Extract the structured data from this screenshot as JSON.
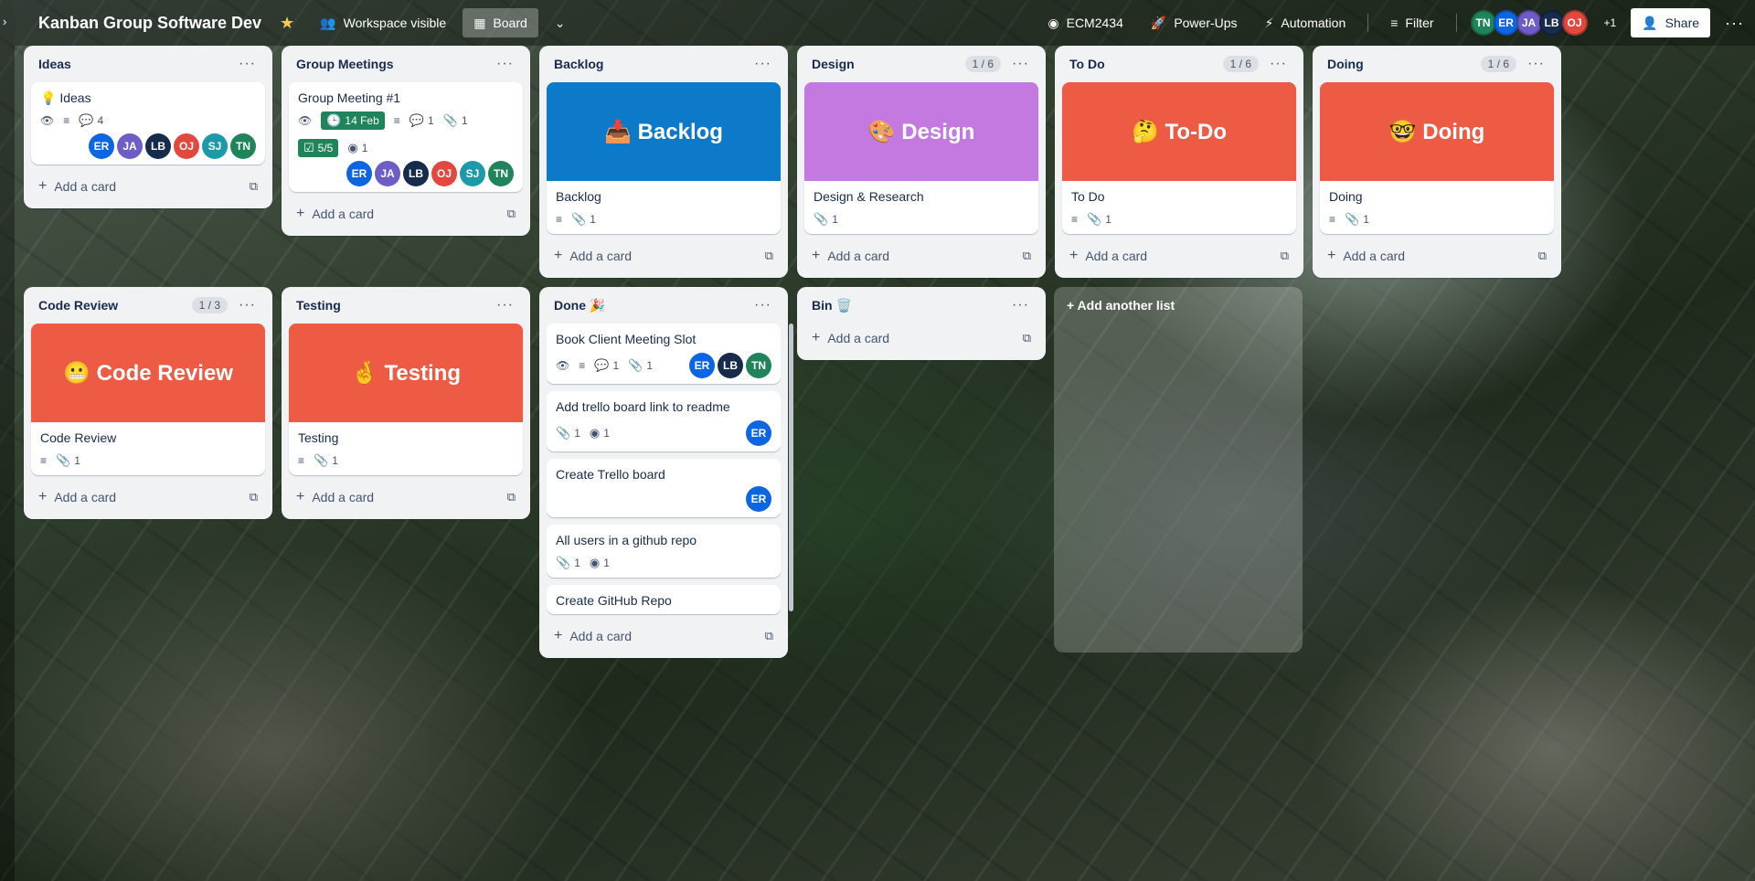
{
  "header": {
    "board_title": "Kanban Group Software Dev",
    "visibility": "Workspace visible",
    "view": "Board",
    "github": "ECM2434",
    "powerups": "Power-Ups",
    "automation": "Automation",
    "filter": "Filter",
    "share": "Share",
    "more_members": "+1"
  },
  "members": [
    {
      "initials": "TN",
      "color": "#1f845a"
    },
    {
      "initials": "ER",
      "color": "#0c66e4"
    },
    {
      "initials": "JA",
      "color": "#6e5dc6"
    },
    {
      "initials": "LB",
      "color": "#172b4d"
    },
    {
      "initials": "OJ",
      "color": "#e2483d"
    }
  ],
  "colors": {
    "er": "#0c66e4",
    "ja": "#6e5dc6",
    "lb": "#172b4d",
    "oj": "#e2483d",
    "sj": "#1d9aaa",
    "tn": "#1f845a",
    "backlog": "#0c7ac9",
    "design": "#c479e0",
    "red": "#ed5b45"
  },
  "add_card": "Add a card",
  "add_list": "+ Add another list",
  "lists": {
    "ideas": {
      "title": "Ideas",
      "card": {
        "title": "Ideas",
        "comments": "4"
      }
    },
    "meetings": {
      "title": "Group Meetings",
      "card": {
        "title": "Group Meeting #1",
        "due": "14 Feb",
        "comments": "1",
        "attachments": "1",
        "checklist": "5/5",
        "github": "1"
      }
    },
    "backlog": {
      "title": "Backlog",
      "cover": "📥 Backlog",
      "card": {
        "title": "Backlog",
        "attachments": "1"
      }
    },
    "design": {
      "title": "Design",
      "count": "1 / 6",
      "cover": "🎨 Design",
      "card": {
        "title": "Design & Research",
        "attachments": "1"
      }
    },
    "todo": {
      "title": "To Do",
      "count": "1 / 6",
      "cover": "🤔 To-Do",
      "card": {
        "title": "To Do",
        "attachments": "1"
      }
    },
    "doing": {
      "title": "Doing",
      "count": "1 / 6",
      "cover": "🤓 Doing",
      "card": {
        "title": "Doing",
        "attachments": "1"
      }
    },
    "review": {
      "title": "Code Review",
      "count": "1 / 3",
      "cover": "😬 Code Review",
      "card": {
        "title": "Code Review",
        "attachments": "1"
      }
    },
    "testing": {
      "title": "Testing",
      "cover": "🤞 Testing",
      "card": {
        "title": "Testing",
        "attachments": "1"
      }
    },
    "done": {
      "title": "Done 🎉",
      "cards": [
        {
          "title": "Book Client Meeting Slot",
          "comments": "1",
          "attachments": "1"
        },
        {
          "title": "Add trello board link to readme",
          "attachments": "1",
          "github": "1"
        },
        {
          "title": "Create Trello board"
        },
        {
          "title": "All users in a github repo",
          "attachments": "1",
          "github": "1"
        },
        {
          "title": "Create GitHub Repo"
        }
      ]
    },
    "bin": {
      "title": "Bin 🗑️"
    }
  }
}
